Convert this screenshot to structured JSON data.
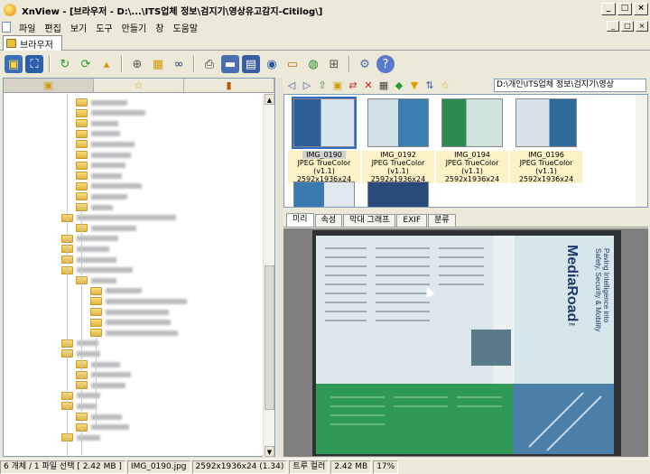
{
  "window": {
    "title": "XnView - [브라우저 - D:\\...\\ITS업체 정보\\검지기\\영상유고감지-Citilog\\]",
    "min": "_",
    "max": "□",
    "close": "×"
  },
  "menu": {
    "items": [
      "파일",
      "편집",
      "보기",
      "도구",
      "만들기",
      "창",
      "도움말"
    ],
    "min": "_",
    "restore": "□",
    "close": "×"
  },
  "tab": {
    "label": "브라우저"
  },
  "toolbar": {
    "icons": [
      "open-folder-icon",
      "fullscreen-icon",
      "refresh-icon",
      "refresh-green-icon",
      "folder-up-icon",
      "zoom-icon",
      "folder-tools-icon",
      "binoculars-icon",
      "print-icon",
      "scanner-icon",
      "slideshow-icon",
      "camera-icon",
      "screen-icon",
      "web-icon",
      "grid-icon",
      "gear-icon",
      "help-icon"
    ]
  },
  "addressbar": {
    "path": "D:\\개인\\ITS업체 정보\\검지기\\영상"
  },
  "thumbnails": [
    {
      "name": "IMG_0190",
      "format": "JPEG TrueColor (v1.1)",
      "dims": "2592x1936x24",
      "badge": "EXIF"
    },
    {
      "name": "IMG_0192",
      "format": "JPEG TrueColor (v1.1)",
      "dims": "2592x1936x24",
      "badge": "EXIF"
    },
    {
      "name": "IMG_0194",
      "format": "JPEG TrueColor (v1.1)",
      "dims": "2592x1936x24",
      "badge": "EXIF"
    },
    {
      "name": "IMG_0196",
      "format": "JPEG TrueColor (v1.1)",
      "dims": "2592x1936x24",
      "badge": "EXIF"
    }
  ],
  "preview_tabs": [
    "미리",
    "속성",
    "막대 그래프",
    "EXIF",
    "분류"
  ],
  "doc": {
    "brand": "MediaRoad",
    "tm": "™",
    "tagline1": "Paving Intelligence into",
    "tagline2": "Safety, Security & Mobility"
  },
  "status": {
    "objects": "6 개체 / 1 파일 선택 [ 2.42 MB ]",
    "file": "IMG_0190.jpg",
    "dims": "2592x1936x24 (1.34)",
    "color": "트루 컬러",
    "size": "2.42 MB",
    "zoom": "17%"
  }
}
